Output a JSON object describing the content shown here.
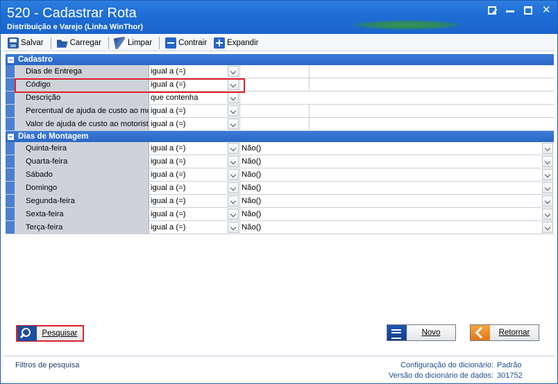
{
  "window": {
    "title": "520 - Cadastrar Rota",
    "subtitle": "Distribuição e Varejo (Linha WinThor)"
  },
  "toolbar": {
    "save_label": "Salvar",
    "load_label": "Carregar",
    "clear_label": "Limpar",
    "collapse_label": "Contrair",
    "expand_label": "Expandir"
  },
  "sections": {
    "cadastro": {
      "title": "Cadastro",
      "rows": [
        {
          "label": "Dias de Entrega",
          "operator": "igual a (=)"
        },
        {
          "label": "Código",
          "operator": "igual a (=)"
        },
        {
          "label": "Descrição",
          "operator": "que contenha"
        },
        {
          "label": "Percentual de ajuda de custo ao motorista",
          "operator": "igual a (=)"
        },
        {
          "label": "Valor de ajuda de custo ao motorista",
          "operator": "igual a (=)"
        }
      ]
    },
    "montagem": {
      "title": "Dias de Montagem",
      "rows": [
        {
          "label": "Quinta-feira",
          "operator": "igual a (=)",
          "value": "Não()"
        },
        {
          "label": "Quarta-feira",
          "operator": "igual a (=)",
          "value": "Não()"
        },
        {
          "label": "Sábado",
          "operator": "igual a (=)",
          "value": "Não()"
        },
        {
          "label": "Domingo",
          "operator": "igual a (=)",
          "value": "Não()"
        },
        {
          "label": "Segunda-feira",
          "operator": "igual a (=)",
          "value": "Não()"
        },
        {
          "label": "Sexta-feira",
          "operator": "igual a (=)",
          "value": "Não()"
        },
        {
          "label": "Terça-feira",
          "operator": "igual a (=)",
          "value": "Não()"
        }
      ]
    }
  },
  "buttons": {
    "search_label": "Pesquisar",
    "new_label": "Novo",
    "back_label": "Retornar"
  },
  "status": {
    "left": "Filtros de pesquisa",
    "dict_config_label": "Configuração do dicionário:",
    "dict_config_value": "Padrão",
    "dict_version_label": "Versão do dicionário de dados:",
    "dict_version_value": "301752"
  },
  "colors": {
    "titlebar": "#1e6ed6",
    "section_header": "#2c67c4",
    "highlight": "#e0202a"
  }
}
